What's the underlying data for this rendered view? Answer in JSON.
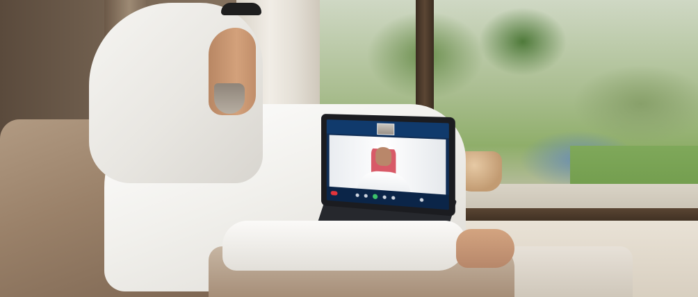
{
  "scene": {
    "subject": "man-in-kandura",
    "setting": "living-room",
    "device": "laptop"
  },
  "laptop": {
    "screen": {
      "participants": [
        "remote-caller",
        "self-view"
      ]
    },
    "toolbar": {
      "controls": [
        "end-call-icon",
        "microphone-icon",
        "camera-icon",
        "share-icon",
        "participants-icon",
        "chat-icon",
        "more-icon"
      ]
    }
  },
  "colors": {
    "end_call": "#e2343b",
    "active_control": "#3cc26a",
    "screen_bg": "#0f2d55"
  }
}
